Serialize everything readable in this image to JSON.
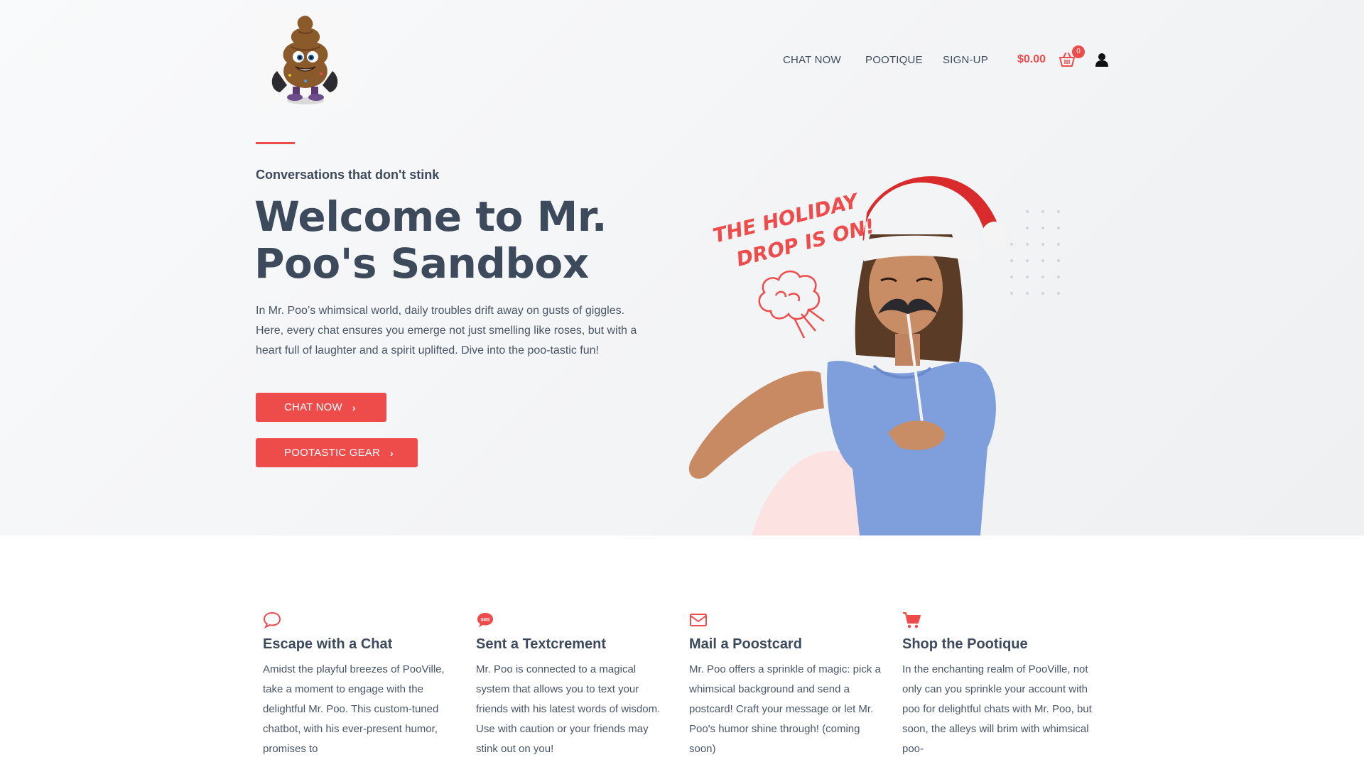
{
  "header": {
    "nav": [
      "CHAT NOW",
      "POOTIQUE",
      "SIGN-UP"
    ],
    "cart_total": "$0.00",
    "cart_count": "0"
  },
  "hero": {
    "tagline": "Conversations that don't stink",
    "headline_line1": "Welcome to Mr.",
    "headline_line2": "Poo's Sandbox",
    "intro": "In Mr. Poo’s whimsical world, daily troubles drift away on gusts of giggles. Here, every chat ensures you emerge not just smelling like roses, but with a heart full of laughter and a spirit uplifted. Dive into the poo-tastic fun!",
    "buttons": [
      "CHAT NOW",
      "POOTASTIC GEAR"
    ],
    "promo_line1": "THE HOLIDAY",
    "promo_line2": "DROP IS ON!"
  },
  "features": [
    {
      "icon": "speech-bubble-icon",
      "title": "Escape with a Chat",
      "text": "Amidst the playful breezes of PooVille, take a moment to engage with the delightful Mr. Poo. This custom-tuned chatbot, with his ever-present humor, promises to"
    },
    {
      "icon": "sms-icon",
      "title": "Sent a Textcrement",
      "text": "Mr. Poo is connected to a magical system that allows you to text your friends with his latest words of wisdom. Use with caution or your friends may stink out on you!"
    },
    {
      "icon": "envelope-icon",
      "title": "Mail a Poostcard",
      "text": "Mr. Poo offers a sprinkle of magic: pick a whimsical background and send a postcard! Craft your message or let Mr. Poo's humor shine through! (coming soon)"
    },
    {
      "icon": "shopping-cart-icon",
      "title": "Shop the Pootique",
      "text": "In the enchanting realm of PooVille, not only can you sprinkle your account with poo for delightful chats with Mr. Poo, but soon, the alleys will brim with whimsical poo-"
    }
  ],
  "colors": {
    "accent": "#ee4b4b",
    "text": "#3d4a5c",
    "shirt": "#7f9fdc"
  }
}
